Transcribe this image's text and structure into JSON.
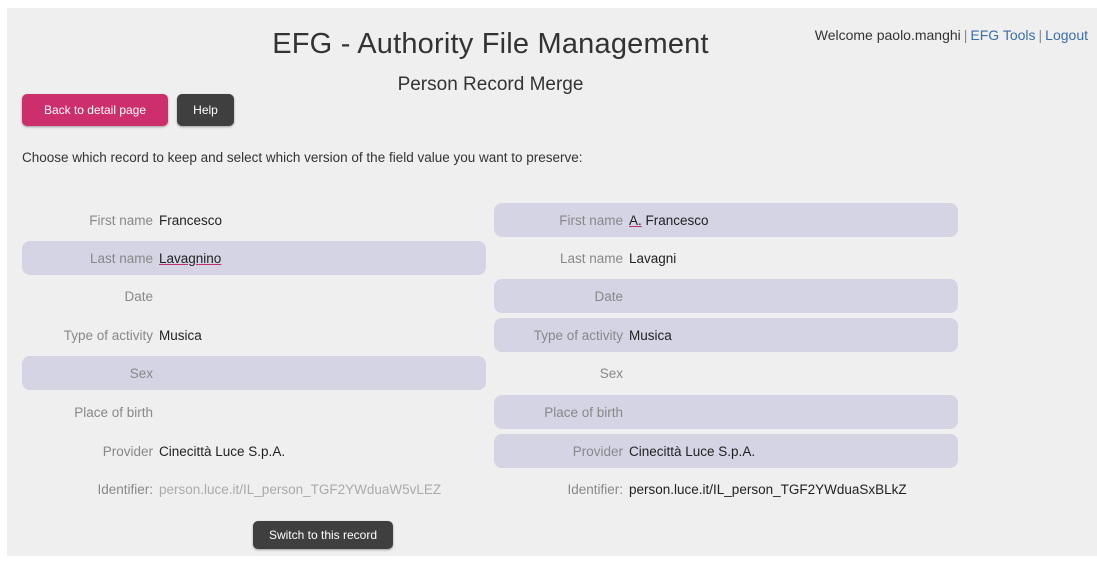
{
  "header": {
    "title": "EFG - Authority File Management",
    "subtitle": "Person Record Merge"
  },
  "userbar": {
    "welcome": "Welcome paolo.manghi",
    "sep1": "|",
    "tools_link": "EFG Tools",
    "sep2": "|",
    "logout_link": "Logout",
    "link_color": "#3a6ea8"
  },
  "buttons": {
    "back": "Back to detail page",
    "help": "Help",
    "switch": "Switch to this record",
    "back_color": "#cc2f6c",
    "dark_color": "#3f3f3f"
  },
  "instruction": "Choose which record to keep and select which version of the field value you want to preserve:",
  "highlight_color": "#d4d4e4",
  "left_record": {
    "fields": [
      {
        "label": "First name",
        "value": "Francesco"
      },
      {
        "label": "Last name",
        "value": "Lavagnino"
      },
      {
        "label": "Date",
        "value": ""
      },
      {
        "label": "Type of activity",
        "value": "Musica"
      },
      {
        "label": "Sex",
        "value": ""
      },
      {
        "label": "Place of birth",
        "value": ""
      },
      {
        "label": "Provider",
        "value": "Cinecittà Luce S.p.A."
      }
    ],
    "identifier_label": "Identifier:",
    "identifier_value": "person.luce.it/IL_person_TGF2YWduaW5vLEZ"
  },
  "right_record": {
    "fields": [
      {
        "label": "First name",
        "value": "A. Francesco"
      },
      {
        "label": "Last name",
        "value": "Lavagni"
      },
      {
        "label": "Date",
        "value": ""
      },
      {
        "label": "Type of activity",
        "value": "Musica"
      },
      {
        "label": "Sex",
        "value": ""
      },
      {
        "label": "Place of birth",
        "value": ""
      },
      {
        "label": "Provider",
        "value": "Cinecittà Luce S.p.A."
      }
    ],
    "identifier_label": "Identifier:",
    "identifier_value": "person.luce.it/IL_person_TGF2YWduaSxBLkZ"
  }
}
